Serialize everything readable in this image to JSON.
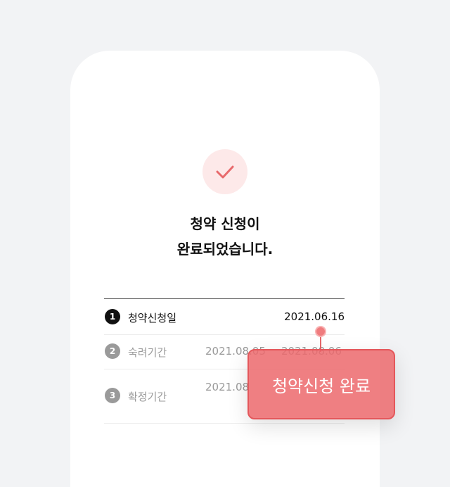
{
  "title": {
    "line1": "청약 신청이",
    "line2": "완료되었습니다."
  },
  "status_icon": "check-icon",
  "colors": {
    "accent": "#e86a6c",
    "accent_light": "#fde9e9",
    "background": "#f2f3f5"
  },
  "steps": [
    {
      "number": "1",
      "label": "청약신청일",
      "date": "2021.06.16",
      "active": true
    },
    {
      "number": "2",
      "label": "숙려기간",
      "date_start": "2021.08.05",
      "date_end": "2021.08.06",
      "active": false
    },
    {
      "number": "3",
      "label": "확정기간",
      "date_start": "2021.08",
      "active": false
    }
  ],
  "callout": {
    "text": "청약신청 완료"
  }
}
